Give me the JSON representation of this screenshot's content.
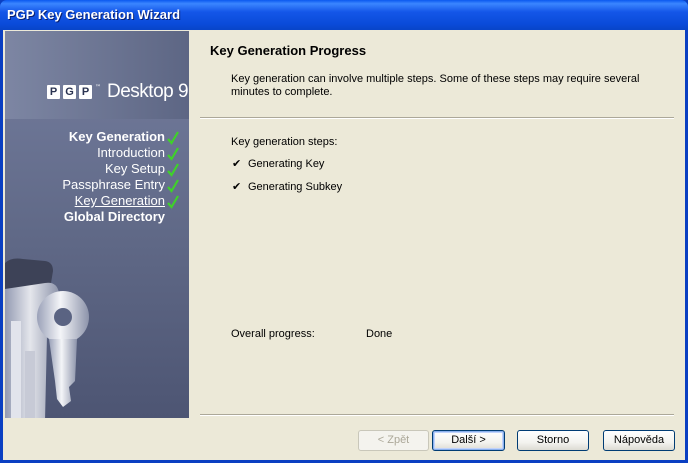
{
  "window": {
    "title": "PGP Key Generation Wizard"
  },
  "sidebar": {
    "logo": {
      "letters": [
        "P",
        "G",
        "P"
      ],
      "trademark": "™",
      "product": "Desktop 9"
    },
    "steps": [
      {
        "label": "Key Generation",
        "bold": true,
        "checked": true
      },
      {
        "label": "Introduction",
        "checked": true
      },
      {
        "label": "Key Setup",
        "checked": true
      },
      {
        "label": "Passphrase Entry",
        "checked": true
      },
      {
        "label": "Key Generation",
        "checked": true,
        "current": true
      },
      {
        "label": "Global Directory",
        "bold": true,
        "checked": false
      }
    ],
    "check_color": "#3fd12a"
  },
  "page": {
    "title": "Key Generation Progress",
    "description": "Key generation can involve multiple steps.  Some of these steps may require several minutes to complete.",
    "steps_label": "Key generation steps:",
    "steps": [
      {
        "label": "Generating Key"
      },
      {
        "label": "Generating Subkey"
      }
    ],
    "progress_label": "Overall progress:",
    "progress_value": "Done"
  },
  "buttons": {
    "back": "< Zpět",
    "next": "Další >",
    "cancel": "Storno",
    "help": "Nápověda"
  }
}
